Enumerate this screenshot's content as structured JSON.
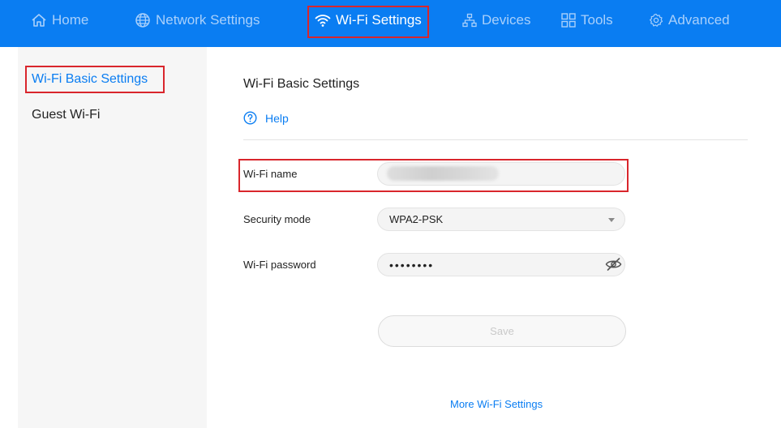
{
  "nav": {
    "items": [
      {
        "label": "Home",
        "icon": "home-icon"
      },
      {
        "label": "Network Settings",
        "icon": "globe-icon"
      },
      {
        "label": "Wi-Fi Settings",
        "icon": "wifi-icon",
        "active": true
      },
      {
        "label": "Devices",
        "icon": "devices-icon"
      },
      {
        "label": "Tools",
        "icon": "tools-icon"
      },
      {
        "label": "Advanced",
        "icon": "gear-icon"
      }
    ]
  },
  "sidebar": {
    "items": [
      {
        "label": "Wi-Fi Basic Settings",
        "active": true
      },
      {
        "label": "Guest Wi-Fi"
      }
    ]
  },
  "main": {
    "title": "Wi-Fi Basic Settings",
    "help_label": "Help",
    "fields": {
      "wifi_name": {
        "label": "Wi-Fi name",
        "value": ""
      },
      "security_mode": {
        "label": "Security mode",
        "value": "WPA2-PSK"
      },
      "wifi_password": {
        "label": "Wi-Fi password",
        "value": "••••••••"
      }
    },
    "save_label": "Save",
    "more_link": "More Wi-Fi Settings"
  },
  "colors": {
    "brand": "#0a7df2",
    "highlight": "#d9262c"
  }
}
